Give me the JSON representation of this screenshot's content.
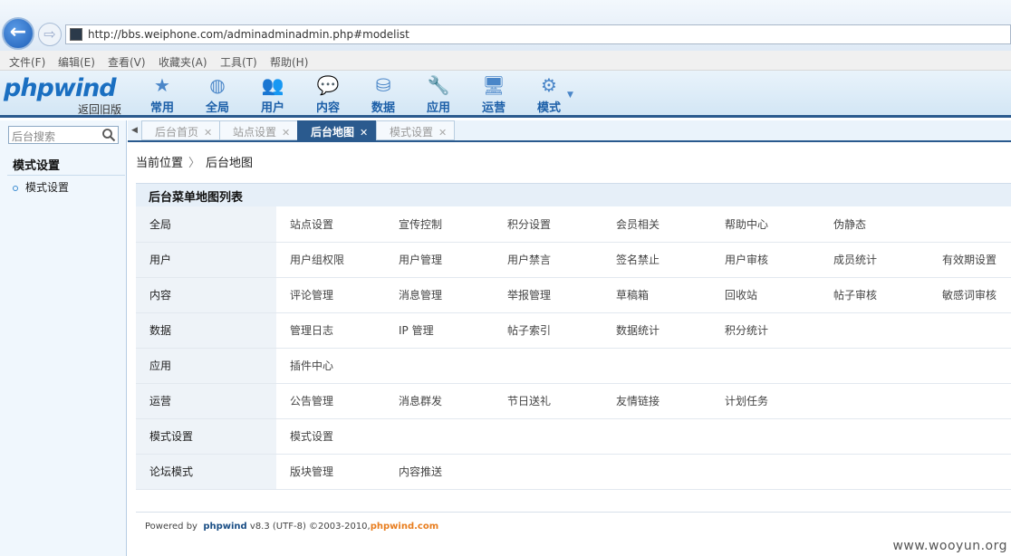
{
  "browser": {
    "url": "http://bbs.weiphone.com/adminadminadmin.php#modelist",
    "back_label": "←",
    "forward_label": "⇨",
    "menu": [
      "文件(F)",
      "编辑(E)",
      "查看(V)",
      "收藏夹(A)",
      "工具(T)",
      "帮助(H)"
    ]
  },
  "header": {
    "logo": "phpwind",
    "old_version_link": "返回旧版",
    "nav": [
      {
        "label": "常用",
        "icon": "star-icon",
        "glyph": "★"
      },
      {
        "label": "全局",
        "icon": "globe-icon",
        "glyph": "◍"
      },
      {
        "label": "用户",
        "icon": "users-icon",
        "glyph": "👥"
      },
      {
        "label": "内容",
        "icon": "chat-icon",
        "glyph": "💬"
      },
      {
        "label": "数据",
        "icon": "database-icon",
        "glyph": "⛁"
      },
      {
        "label": "应用",
        "icon": "wrench-icon",
        "glyph": "🔧"
      },
      {
        "label": "运营",
        "icon": "monitor-icon",
        "glyph": "🖥"
      },
      {
        "label": "模式",
        "icon": "gear-icon",
        "glyph": "⚙"
      }
    ]
  },
  "sidebar": {
    "search_placeholder": "后台搜索",
    "title": "模式设置",
    "items": [
      {
        "label": "模式设置"
      }
    ]
  },
  "tabs": [
    {
      "label": "后台首页",
      "active": false
    },
    {
      "label": "站点设置",
      "active": false
    },
    {
      "label": "后台地图",
      "active": true
    },
    {
      "label": "模式设置",
      "active": false
    }
  ],
  "breadcrumb": {
    "root": "当前位置",
    "sep": "〉",
    "current": "后台地图"
  },
  "map": {
    "title": "后台菜单地图列表",
    "rows": [
      {
        "category": "全局",
        "links": [
          "站点设置",
          "宣传控制",
          "积分设置",
          "会员相关",
          "帮助中心",
          "伪静态",
          ""
        ]
      },
      {
        "category": "用户",
        "links": [
          "用户组权限",
          "用户管理",
          "用户禁言",
          "签名禁止",
          "用户审核",
          "成员统计",
          "有效期设置"
        ]
      },
      {
        "category": "内容",
        "links": [
          "评论管理",
          "消息管理",
          "举报管理",
          "草稿箱",
          "回收站",
          "帖子审核",
          "敏感词审核"
        ]
      },
      {
        "category": "数据",
        "links": [
          "管理日志",
          "IP 管理",
          "帖子索引",
          "数据统计",
          "积分统计",
          "",
          ""
        ]
      },
      {
        "category": "应用",
        "links": [
          "插件中心",
          "",
          "",
          "",
          "",
          "",
          ""
        ]
      },
      {
        "category": "运营",
        "links": [
          "公告管理",
          "消息群发",
          "节日送礼",
          "友情链接",
          "计划任务",
          "",
          ""
        ]
      },
      {
        "category": "模式设置",
        "links": [
          "模式设置",
          "",
          "",
          "",
          "",
          "",
          ""
        ]
      },
      {
        "category": "论坛模式",
        "links": [
          "版块管理",
          "内容推送",
          "",
          "",
          "",
          "",
          ""
        ]
      }
    ]
  },
  "footer": {
    "powered": "Powered by",
    "product": "phpwind",
    "version": "v8.3 (UTF-8) ©2003-2010,",
    "site": "phpwind.com"
  },
  "watermark": "www.wooyun.org"
}
